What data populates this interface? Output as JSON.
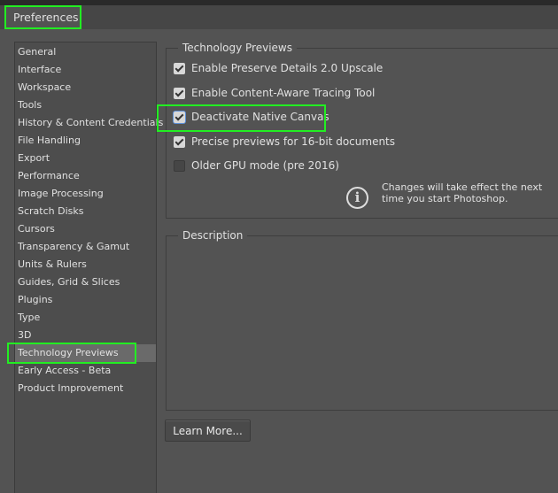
{
  "window": {
    "title": "Preferences"
  },
  "sidebar": {
    "items": [
      {
        "label": "General"
      },
      {
        "label": "Interface"
      },
      {
        "label": "Workspace"
      },
      {
        "label": "Tools"
      },
      {
        "label": "History & Content Credentials"
      },
      {
        "label": "File Handling"
      },
      {
        "label": "Export"
      },
      {
        "label": "Performance"
      },
      {
        "label": "Image Processing"
      },
      {
        "label": "Scratch Disks"
      },
      {
        "label": "Cursors"
      },
      {
        "label": "Transparency & Gamut"
      },
      {
        "label": "Units & Rulers"
      },
      {
        "label": "Guides, Grid & Slices"
      },
      {
        "label": "Plugins"
      },
      {
        "label": "Type"
      },
      {
        "label": "3D"
      },
      {
        "label": "Technology Previews",
        "selected": true
      },
      {
        "label": "Early Access - Beta"
      },
      {
        "label": "Product Improvement"
      }
    ]
  },
  "tech_previews": {
    "title": "Technology Previews",
    "options": [
      {
        "label": "Enable Preserve Details 2.0 Upscale",
        "checked": true
      },
      {
        "label": "Enable Content-Aware Tracing Tool",
        "checked": true
      },
      {
        "label": "Deactivate Native Canvas",
        "checked": true
      },
      {
        "label": "Precise previews for 16-bit documents",
        "checked": true
      },
      {
        "label": "Older GPU mode (pre 2016)",
        "checked": false
      }
    ],
    "info_icon": "info-icon",
    "info_text": "Changes will take effect the next time you start Photoshop."
  },
  "description": {
    "title": "Description"
  },
  "learn_more": "Learn More...",
  "colors": {
    "highlight": "#22ee22",
    "background": "#535353"
  }
}
